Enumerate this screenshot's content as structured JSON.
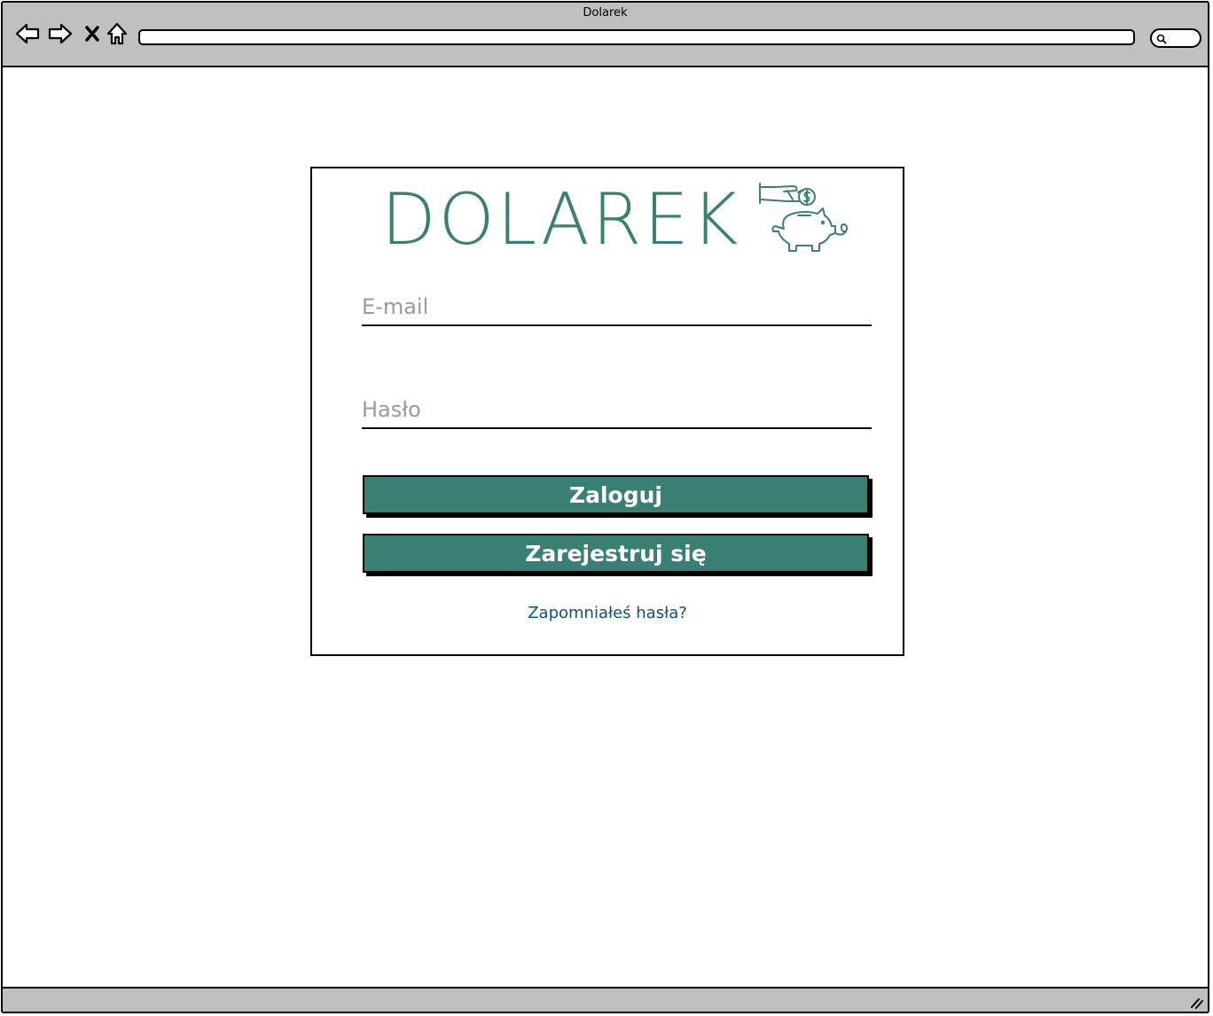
{
  "window": {
    "title": "Dolarek"
  },
  "login": {
    "logo_text": "DOLAREK",
    "email_placeholder": "E-mail",
    "password_placeholder": "Hasło",
    "login_button": "Zaloguj",
    "register_button": "Zarejestruj się",
    "forgot_link": "Zapomniałeś hasła?"
  },
  "colors": {
    "accent": "#3a7f74",
    "link": "#0b4f8a",
    "chrome": "#c0c0c0"
  },
  "icons": [
    "back-arrow-icon",
    "forward-arrow-icon",
    "close-icon",
    "home-icon",
    "search-icon",
    "piggy-bank-coin-icon",
    "resize-grip-icon"
  ]
}
